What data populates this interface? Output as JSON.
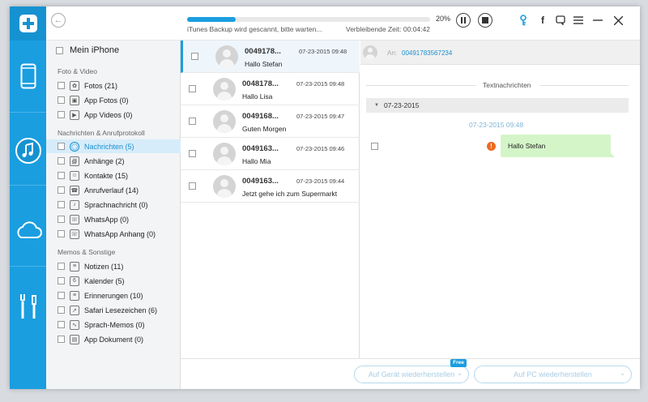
{
  "topbar": {
    "back_icon": "back-arrow-icon",
    "progress_percent": 20,
    "progress_label": "20%",
    "status_text": "iTunes Backup wird gescannt, bitte warten...",
    "remaining_text": "Verbleibende Zeit: 00:04:42",
    "icons": [
      "pause-icon",
      "stop-icon",
      "key-icon",
      "facebook-icon",
      "feedback-icon",
      "menu-icon",
      "minimize-icon",
      "close-icon"
    ]
  },
  "rail": {
    "items": [
      "phone-icon",
      "music-icon",
      "cloud-icon",
      "tools-icon"
    ],
    "accent": "#1a9ee0"
  },
  "device": {
    "name": "Mein iPhone"
  },
  "categories": {
    "sections": [
      {
        "title": "Foto & Video",
        "items": [
          {
            "label": "Fotos (21)",
            "icon": "photos-icon"
          },
          {
            "label": "App Fotos (0)",
            "icon": "app-photos-icon"
          },
          {
            "label": "App Videos (0)",
            "icon": "app-videos-icon"
          }
        ]
      },
      {
        "title": "Nachrichten & Anrufprotokoll",
        "items": [
          {
            "label": "Nachrichten (5)",
            "icon": "messages-icon",
            "active": true
          },
          {
            "label": "Anhänge (2)",
            "icon": "attachment-icon"
          },
          {
            "label": "Kontakte (15)",
            "icon": "contacts-icon"
          },
          {
            "label": "Anrufverlauf (14)",
            "icon": "call-history-icon"
          },
          {
            "label": "Sprachnachricht (0)",
            "icon": "voicemail-icon"
          },
          {
            "label": "WhatsApp (0)",
            "icon": "whatsapp-icon"
          },
          {
            "label": "WhatsApp Anhang (0)",
            "icon": "whatsapp-attachment-icon"
          }
        ]
      },
      {
        "title": "Memos & Sonstige",
        "items": [
          {
            "label": "Notizen (11)",
            "icon": "notes-icon"
          },
          {
            "label": "Kalender (5)",
            "icon": "calendar-icon"
          },
          {
            "label": "Erinnerungen (10)",
            "icon": "reminders-icon"
          },
          {
            "label": "Safari Lesezeichen (6)",
            "icon": "safari-bookmarks-icon"
          },
          {
            "label": "Sprach-Memos (0)",
            "icon": "voice-memos-icon"
          },
          {
            "label": "App Dokument (0)",
            "icon": "app-document-icon"
          }
        ]
      }
    ]
  },
  "messages": [
    {
      "number": "0049178...",
      "time": "07-23-2015 09:48",
      "preview": "Hallo Stefan",
      "selected": true
    },
    {
      "number": "0048178...",
      "time": "07-23-2015 09:48",
      "preview": "Hallo Lisa"
    },
    {
      "number": "0049168...",
      "time": "07-23-2015 09:47",
      "preview": "Guten Morgen"
    },
    {
      "number": "0049163...",
      "time": "07-23-2015 09:46",
      "preview": "Hallo Mia"
    },
    {
      "number": "0049163...",
      "time": "07-23-2015 09:44",
      "preview": "Jetzt gehe ich zum Supermarkt"
    }
  ],
  "detail": {
    "to_label": "An:",
    "to_value": "00491783567234",
    "section_label": "Textnachrichten",
    "date_group": "07-23-2015",
    "message_time": "07-23-2015 09:48",
    "message_text": "Hallo Stefan",
    "warning_glyph": "!"
  },
  "bottombar": {
    "restore_device": "Auf Gerät wiederherstellen",
    "free_badge": "Free",
    "restore_pc": "Auf PC wiederherstellen"
  }
}
